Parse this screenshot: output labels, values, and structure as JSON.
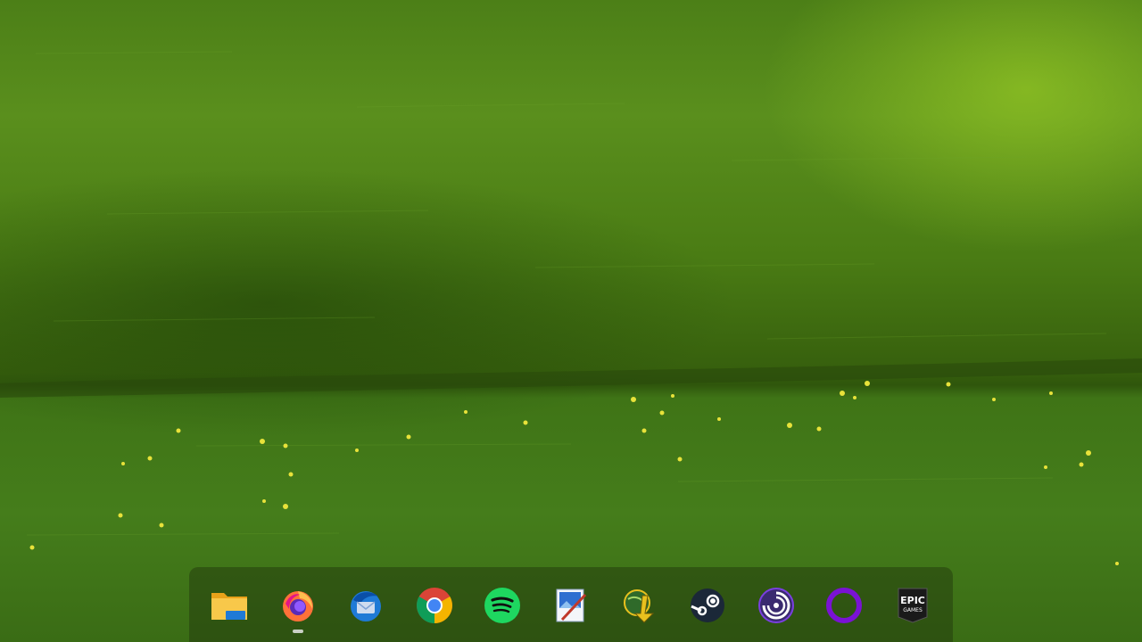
{
  "desktop": {
    "wallpaper": "green-grass-field-with-yellow-flowers"
  },
  "taskbar": {
    "apps": [
      {
        "id": "file-explorer",
        "icon": "folder-icon",
        "color": "#f4b93a",
        "running": false
      },
      {
        "id": "firefox",
        "icon": "firefox-icon",
        "color": "#ff7139",
        "running": true
      },
      {
        "id": "thunderbird",
        "icon": "thunderbird-icon",
        "color": "#1f7ad6",
        "running": false
      },
      {
        "id": "chrome",
        "icon": "chrome-icon",
        "color": "#34a853",
        "running": false
      },
      {
        "id": "spotify",
        "icon": "spotify-icon",
        "color": "#1ed760",
        "running": false
      },
      {
        "id": "paint",
        "icon": "paint-icon",
        "color": "#2f6fd0",
        "running": false
      },
      {
        "id": "jdownloader",
        "icon": "jdownloader-icon",
        "color": "#e8c11e",
        "running": false
      },
      {
        "id": "steam",
        "icon": "steam-icon",
        "color": "#1b2838",
        "running": false
      },
      {
        "id": "ubisoft-connect",
        "icon": "ubisoft-icon",
        "color": "#7a3fe0",
        "running": false
      },
      {
        "id": "cortana",
        "icon": "cortana-ring-icon",
        "color": "#7a12d4",
        "running": false
      },
      {
        "id": "epic-games",
        "icon": "epic-games-icon",
        "color": "#1a1a1a",
        "running": false,
        "label_line1": "EPIC",
        "label_line2": "GAMES"
      }
    ]
  }
}
